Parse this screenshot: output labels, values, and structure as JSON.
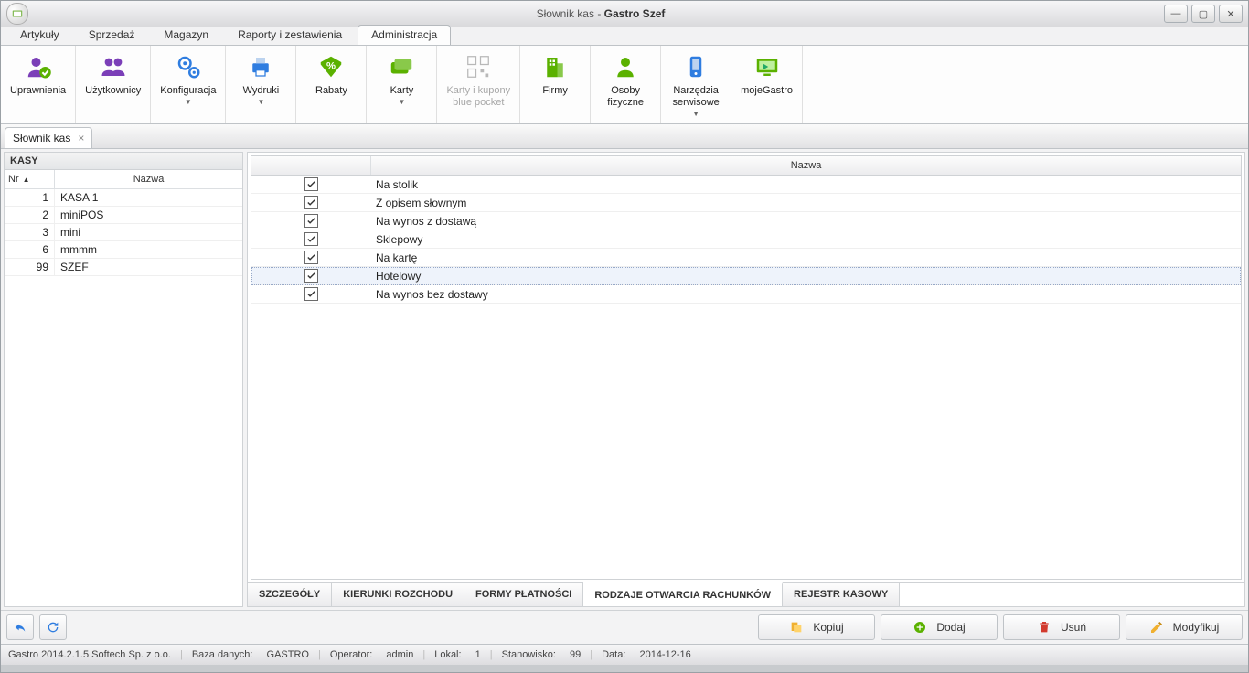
{
  "title": {
    "doc": "Słownik kas",
    "app": "Gastro Szef"
  },
  "menu": {
    "items": [
      "Artykuły",
      "Sprzedaż",
      "Magazyn",
      "Raporty i zestawienia",
      "Administracja"
    ],
    "active": 4
  },
  "ribbon": [
    {
      "key": "uprawnienia",
      "label": "Uprawnienia",
      "icon": "user-check",
      "color": "#7b3fb8"
    },
    {
      "key": "uzytkownicy",
      "label": "Użytkownicy",
      "icon": "users",
      "color": "#7b3fb8"
    },
    {
      "key": "konfiguracja",
      "label": "Konfiguracja",
      "icon": "gears",
      "color": "#2f7de0",
      "caret": true
    },
    {
      "key": "wydruki",
      "label": "Wydruki",
      "icon": "printer",
      "color": "#2f7de0",
      "caret": true
    },
    {
      "key": "rabaty",
      "label": "Rabaty",
      "icon": "percent",
      "color": "#5bb100"
    },
    {
      "key": "karty",
      "label": "Karty",
      "icon": "cards",
      "color": "#5bb100",
      "caret": true
    },
    {
      "key": "bluepocket",
      "label": "Karty i kupony\nblue pocket",
      "icon": "qr",
      "color": "#b8b8b8",
      "disabled": true
    },
    {
      "key": "firmy",
      "label": "Firmy",
      "icon": "building",
      "color": "#5bb100"
    },
    {
      "key": "osoby",
      "label": "Osoby\nfizyczne",
      "icon": "person",
      "color": "#5bb100"
    },
    {
      "key": "narzedzia",
      "label": "Narzędzia\nserwisowe",
      "icon": "device",
      "color": "#2f7de0",
      "caret": true
    },
    {
      "key": "mojegastro",
      "label": "mojeGastro",
      "icon": "monitor",
      "color": "#5bb100"
    }
  ],
  "doc_tab": {
    "label": "Słownik kas"
  },
  "left": {
    "header": "KASY",
    "cols": {
      "nr": "Nr",
      "nazwa": "Nazwa"
    },
    "rows": [
      {
        "nr": 1,
        "nazwa": "KASA 1"
      },
      {
        "nr": 2,
        "nazwa": "miniPOS"
      },
      {
        "nr": 3,
        "nazwa": "mini"
      },
      {
        "nr": 6,
        "nazwa": "mmmm"
      },
      {
        "nr": 99,
        "nazwa": "SZEF"
      }
    ]
  },
  "grid": {
    "col_name": "Nazwa",
    "rows": [
      {
        "checked": true,
        "name": "Na stolik"
      },
      {
        "checked": true,
        "name": "Z opisem słownym"
      },
      {
        "checked": true,
        "name": "Na wynos z dostawą"
      },
      {
        "checked": true,
        "name": "Sklepowy"
      },
      {
        "checked": true,
        "name": "Na kartę"
      },
      {
        "checked": true,
        "name": "Hotelowy",
        "selected": true
      },
      {
        "checked": true,
        "name": "Na wynos bez dostawy"
      }
    ]
  },
  "bottom_tabs": {
    "items": [
      "SZCZEGÓŁY",
      "KIERUNKI ROZCHODU",
      "FORMY PŁATNOŚCI",
      "RODZAJE OTWARCIA RACHUNKÓW",
      "REJESTR KASOWY"
    ],
    "active": 3
  },
  "actions": {
    "kopiuj": "Kopiuj",
    "dodaj": "Dodaj",
    "usun": "Usuń",
    "modyfikuj": "Modyfikuj"
  },
  "status": {
    "ver": "Gastro 2014.2.1.5  Softech Sp. z o.o.",
    "db_l": "Baza danych:",
    "db_v": "GASTRO",
    "op_l": "Operator:",
    "op_v": "admin",
    "lok_l": "Lokal:",
    "lok_v": "1",
    "stan_l": "Stanowisko:",
    "stan_v": "99",
    "data_l": "Data:",
    "data_v": "2014-12-16"
  }
}
